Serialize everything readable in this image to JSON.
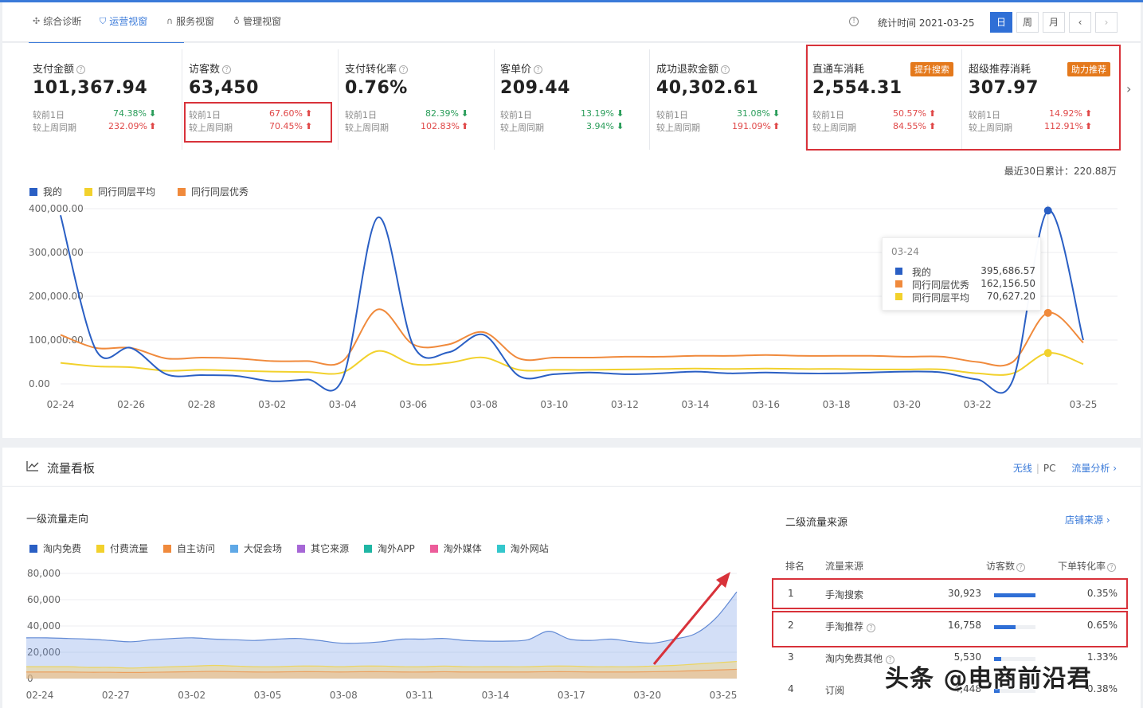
{
  "nav": {
    "tabs": [
      {
        "label": "综合诊断",
        "icon": "diagnosis-icon"
      },
      {
        "label": "运营视窗",
        "icon": "shield-icon"
      },
      {
        "label": "服务视窗",
        "icon": "headset-icon"
      },
      {
        "label": "管理视窗",
        "icon": "medal-icon"
      }
    ],
    "stat_time": "统计时间 2021-03-25",
    "period_buttons": [
      "日",
      "周",
      "月"
    ],
    "prev": "‹",
    "next": "›"
  },
  "kpis": [
    {
      "name": "支付金额",
      "value": "101,367.94",
      "c1_label": "较前1日",
      "c1_pct": "74.38%",
      "c1_dir": "down",
      "c2_label": "较上周同期",
      "c2_pct": "232.09%",
      "c2_dir": "up"
    },
    {
      "name": "访客数",
      "value": "63,450",
      "c1_label": "较前1日",
      "c1_pct": "67.60%",
      "c1_dir": "up",
      "c2_label": "较上周同期",
      "c2_pct": "70.45%",
      "c2_dir": "up"
    },
    {
      "name": "支付转化率",
      "value": "0.76%",
      "c1_label": "较前1日",
      "c1_pct": "82.39%",
      "c1_dir": "down",
      "c2_label": "较上周同期",
      "c2_pct": "102.83%",
      "c2_dir": "up"
    },
    {
      "name": "客单价",
      "value": "209.44",
      "c1_label": "较前1日",
      "c1_pct": "13.19%",
      "c1_dir": "down",
      "c2_label": "较上周同期",
      "c2_pct": "3.94%",
      "c2_dir": "down"
    },
    {
      "name": "成功退款金额",
      "value": "40,302.61",
      "c1_label": "较前1日",
      "c1_pct": "31.08%",
      "c1_dir": "down",
      "c2_label": "较上周同期",
      "c2_pct": "191.09%",
      "c2_dir": "up"
    },
    {
      "name": "直通车消耗",
      "value": "2,554.31",
      "badge": "提升搜索",
      "c1_label": "较前1日",
      "c1_pct": "50.57%",
      "c1_dir": "up",
      "c2_label": "较上周同期",
      "c2_pct": "84.55%",
      "c2_dir": "up"
    },
    {
      "name": "超级推荐消耗",
      "value": "307.97",
      "badge": "助力推荐",
      "c1_label": "较前1日",
      "c1_pct": "14.92%",
      "c1_dir": "up",
      "c2_label": "较上周同期",
      "c2_pct": "112.91%",
      "c2_dir": "up"
    }
  ],
  "total_30d": "最近30日累计：220.88万",
  "tooltip": {
    "date": "03-24",
    "rows": [
      {
        "name": "我的",
        "value": "395,686.57",
        "color": "#2a5fc4"
      },
      {
        "name": "同行同层优秀",
        "value": "162,156.50",
        "color": "#f08a3c"
      },
      {
        "name": "同行同层平均",
        "value": "70,627.20",
        "color": "#f2d12c"
      }
    ]
  },
  "traffic": {
    "title": "流量看板",
    "links": {
      "wireless": "无线",
      "pc": "PC",
      "analysis": "流量分析 ›"
    },
    "level1_title": "一级流量走向",
    "level2_title": "二级流量来源",
    "shop_source_link": "店铺来源 ›",
    "table_headers": {
      "rank": "排名",
      "source": "流量来源",
      "visitors": "访客数",
      "conversion": "下单转化率"
    },
    "table_rows": [
      {
        "rank": "1",
        "source": "手淘搜索",
        "visitors": "30,923",
        "share": 1.0,
        "conversion": "0.35%"
      },
      {
        "rank": "2",
        "source": "手淘推荐",
        "visitors": "16,758",
        "share": 0.52,
        "conversion": "0.65%",
        "has_q": true
      },
      {
        "rank": "3",
        "source": "淘内免费其他",
        "visitors": "5,530",
        "share": 0.17,
        "conversion": "1.33%",
        "has_q": true
      },
      {
        "rank": "4",
        "source": "订阅",
        "visitors": "4,448",
        "share": 0.14,
        "conversion": "0.38%"
      }
    ]
  },
  "watermark": "头条 @电商前沿君",
  "chart_data": [
    {
      "type": "line",
      "title": "",
      "x": [
        "02-24",
        "02-25",
        "02-26",
        "02-27",
        "02-28",
        "03-01",
        "03-02",
        "03-03",
        "03-04",
        "03-05",
        "03-06",
        "03-07",
        "03-08",
        "03-09",
        "03-10",
        "03-11",
        "03-12",
        "03-13",
        "03-14",
        "03-15",
        "03-16",
        "03-17",
        "03-18",
        "03-19",
        "03-20",
        "03-21",
        "03-22",
        "03-23",
        "03-24",
        "03-25"
      ],
      "x_tick_labels": [
        "02-24",
        "02-26",
        "02-28",
        "03-02",
        "03-04",
        "03-06",
        "03-08",
        "03-10",
        "03-12",
        "03-14",
        "03-16",
        "03-18",
        "03-20",
        "03-22",
        "03-25"
      ],
      "y_tick_labels": [
        "400,000.00",
        "300,000.00",
        "200,000.00",
        "100,000.00",
        "0.00"
      ],
      "ylim": [
        0,
        400000
      ],
      "legend": "top-left",
      "series": [
        {
          "name": "我的",
          "color": "#2a5fc4",
          "values": [
            385000,
            78000,
            82000,
            22000,
            20000,
            18000,
            6000,
            10000,
            12000,
            380000,
            88000,
            72000,
            112000,
            18000,
            22000,
            26000,
            22000,
            24000,
            28000,
            24000,
            26000,
            24000,
            24000,
            26000,
            28000,
            26000,
            10000,
            8000,
            395686.57,
            100000
          ]
        },
        {
          "name": "同行同层平均",
          "color": "#f2d12c",
          "values": [
            48000,
            40000,
            38000,
            30000,
            32000,
            30000,
            28000,
            27000,
            26000,
            75000,
            45000,
            48000,
            60000,
            32000,
            32000,
            32000,
            33000,
            34000,
            35000,
            34000,
            35000,
            34000,
            34000,
            33000,
            33000,
            33000,
            24000,
            24000,
            70627.2,
            45000
          ]
        },
        {
          "name": "同行同层优秀",
          "color": "#f08a3c",
          "values": [
            112000,
            82000,
            82000,
            58000,
            60000,
            58000,
            52000,
            52000,
            52000,
            170000,
            90000,
            90000,
            118000,
            58000,
            60000,
            60000,
            62000,
            62000,
            64000,
            64000,
            66000,
            64000,
            64000,
            64000,
            62000,
            62000,
            50000,
            50000,
            162156.5,
            94000
          ]
        }
      ]
    },
    {
      "type": "area",
      "title": "",
      "x_tick_labels": [
        "02-24",
        "02-27",
        "03-02",
        "03-05",
        "03-08",
        "03-11",
        "03-14",
        "03-17",
        "03-20",
        "03-25"
      ],
      "y_tick_labels": [
        "80,000",
        "60,000",
        "40,000",
        "20,000",
        "0"
      ],
      "ylim": [
        0,
        80000
      ],
      "legend": "top-left",
      "series": [
        {
          "name": "淘内免费",
          "color": "#2a5fc4",
          "values": [
            31000,
            31000,
            30500,
            30000,
            29000,
            28000,
            29500,
            30500,
            31000,
            30000,
            29500,
            29000,
            30000,
            30500,
            29000,
            27000,
            27000,
            28000,
            30000,
            30000,
            30500,
            29000,
            28500,
            28500,
            29500,
            36000,
            30000,
            29000,
            30000,
            28000,
            27000,
            30000,
            34000,
            46000,
            66000
          ]
        },
        {
          "name": "付费流量",
          "color": "#f2d12c",
          "values": [
            9000,
            9000,
            9000,
            8500,
            8500,
            8000,
            8500,
            9000,
            9500,
            10000,
            9500,
            9000,
            9000,
            9500,
            9500,
            9000,
            9500,
            9500,
            9000,
            9000,
            9500,
            9000,
            9000,
            9000,
            9000,
            9500,
            9500,
            9000,
            9000,
            9000,
            9500,
            10000,
            11000,
            12000,
            13000
          ]
        },
        {
          "name": "自主访问",
          "color": "#f08a3c",
          "values": [
            5000,
            5000,
            5000,
            4800,
            4800,
            4600,
            4800,
            5000,
            5200,
            5500,
            5200,
            5000,
            5000,
            5200,
            5200,
            5000,
            5200,
            5200,
            5000,
            5000,
            5200,
            5000,
            5000,
            5000,
            5000,
            5200,
            5200,
            5000,
            5000,
            5000,
            5200,
            5500,
            6000,
            6500,
            7000
          ]
        },
        {
          "name": "大促会场",
          "color": "#5fa8e6",
          "values": []
        },
        {
          "name": "其它来源",
          "color": "#a667d6",
          "values": []
        },
        {
          "name": "淘外APP",
          "color": "#1fb6a4",
          "values": []
        },
        {
          "name": "淘外媒体",
          "color": "#ec5c9a",
          "values": []
        },
        {
          "name": "淘外网站",
          "color": "#34c7cc",
          "values": []
        }
      ]
    }
  ]
}
